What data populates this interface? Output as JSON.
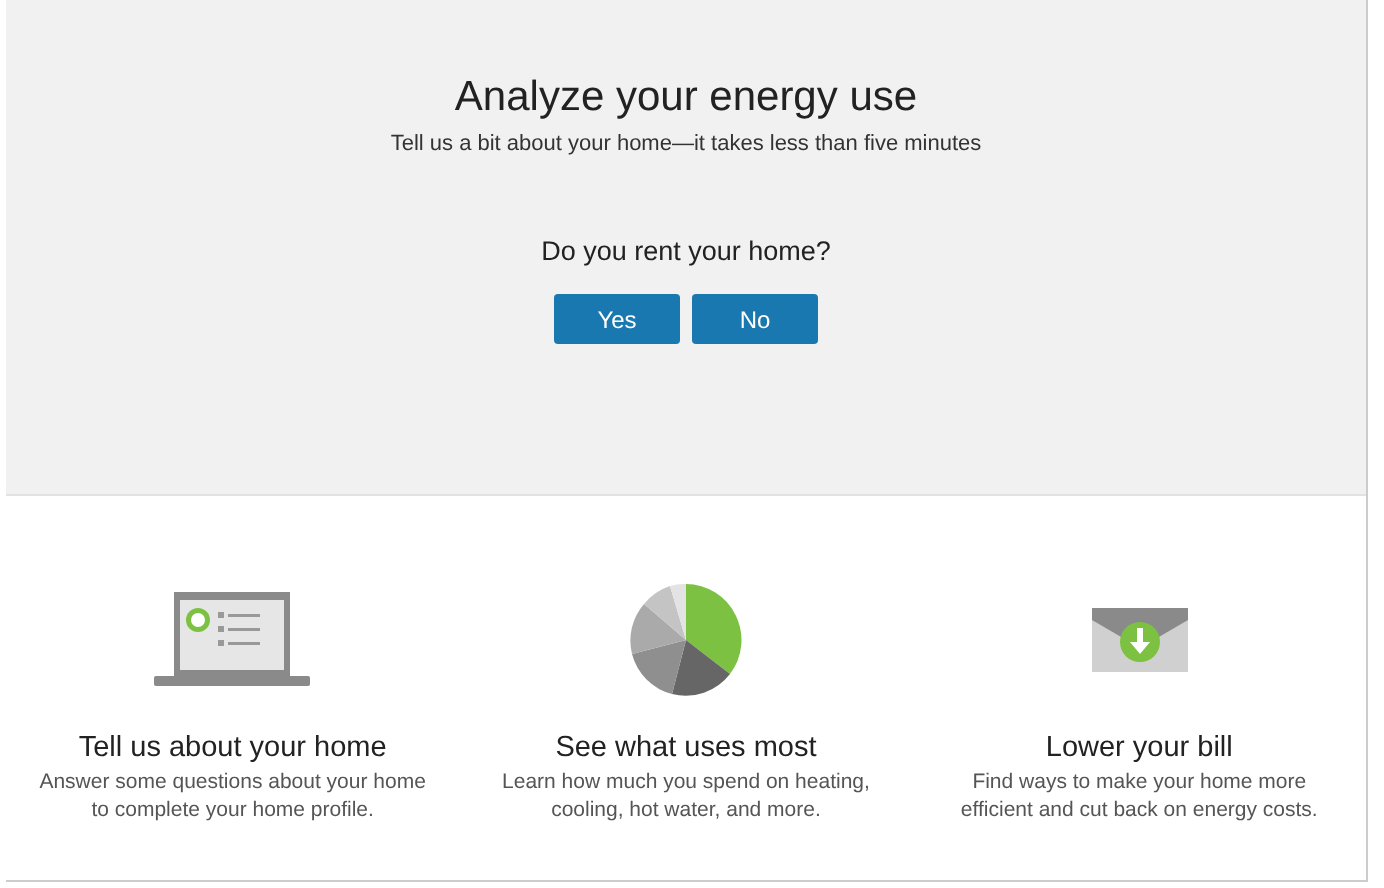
{
  "hero": {
    "title": "Analyze your energy use",
    "subtitle": "Tell us a bit about your home—it takes less than five minutes",
    "question": "Do you rent your home?",
    "buttons": [
      "Yes",
      "No"
    ]
  },
  "features": [
    {
      "kind": "laptop",
      "title": "Tell us about your home",
      "text": "Answer some questions about your home to complete your home profile."
    },
    {
      "kind": "pie",
      "title": "See what uses most",
      "text": "Learn how much you spend on heating, cooling, hot water, and more."
    },
    {
      "kind": "envelope",
      "title": "Lower your bill",
      "text": "Find ways to make your home more efficient and cut back on energy costs."
    }
  ]
}
